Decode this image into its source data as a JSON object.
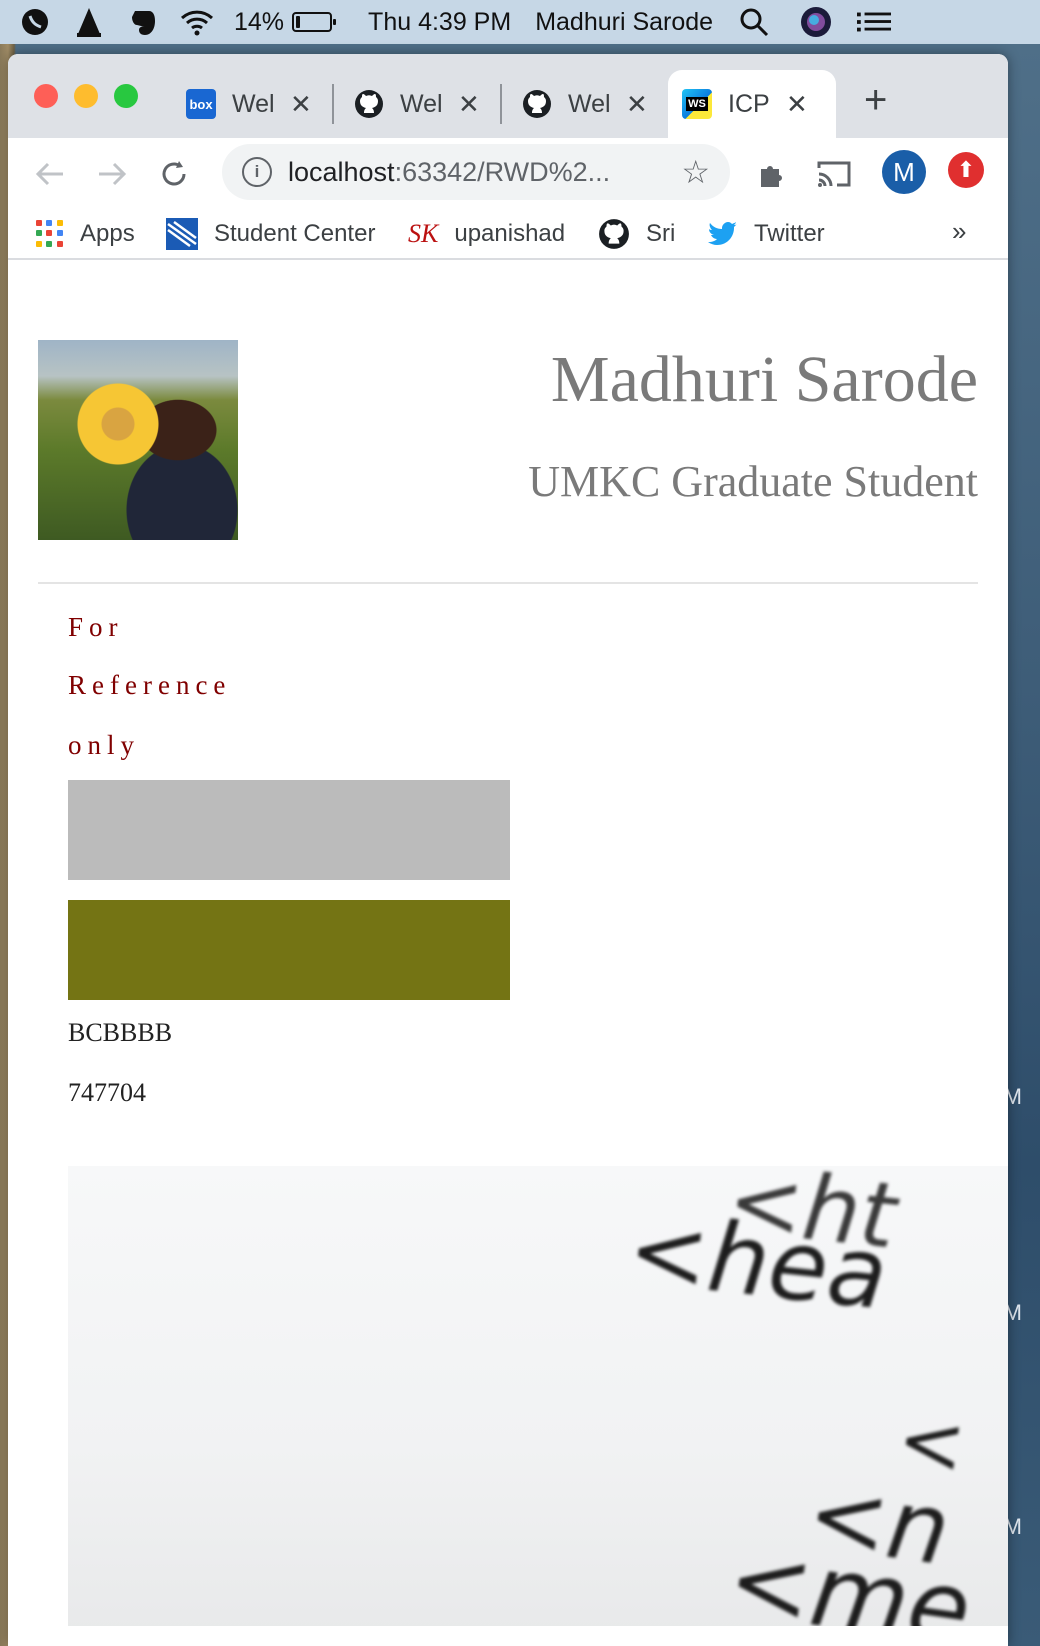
{
  "menubar": {
    "battery_percent": "14%",
    "battery_level": 0.14,
    "datetime": "Thu 4:39 PM",
    "user_name": "Madhuri Sarode",
    "icons": [
      "viber-icon",
      "vlc-icon",
      "evernote-icon",
      "wifi-icon",
      "battery-icon",
      "search-icon",
      "siri-icon",
      "control-center-icon"
    ]
  },
  "browser": {
    "tabs": [
      {
        "title": "Wel",
        "favicon": "box-icon",
        "favicon_text": "box",
        "active": false
      },
      {
        "title": "Wel",
        "favicon": "github-icon",
        "active": false
      },
      {
        "title": "Wel",
        "favicon": "github-icon",
        "active": false
      },
      {
        "title": "ICP",
        "favicon": "webstorm-icon",
        "favicon_text": "WS",
        "active": true
      }
    ],
    "new_tab_label": "+",
    "url_host": "localhost",
    "url_rest": ":63342/RWD%2...",
    "profile_initial": "M",
    "bookmarks": [
      {
        "label": "Apps",
        "icon": "apps-grid-icon"
      },
      {
        "label": "Student Center",
        "icon": "student-center-icon"
      },
      {
        "label": "upanishad",
        "icon": "sk-icon",
        "icon_text": "SK"
      },
      {
        "label": "Sri",
        "icon": "github-icon"
      },
      {
        "label": "Twitter",
        "icon": "twitter-icon"
      }
    ],
    "bookmarks_overflow": "»"
  },
  "page": {
    "name": "Madhuri Sarode",
    "subtitle": "UMKC Graduate Student",
    "reference_lines": [
      "For",
      "Reference",
      "only"
    ],
    "swatches": [
      {
        "color": "#BBBBBB"
      },
      {
        "color": "#747414"
      }
    ],
    "color_codes": [
      "BCBBBB",
      "747704"
    ]
  },
  "colors": {
    "accent_maroon": "#800000",
    "heading_gray": "#7a7a7a",
    "profile_blue": "#1a5ea8",
    "update_red": "#e02f2f"
  }
}
